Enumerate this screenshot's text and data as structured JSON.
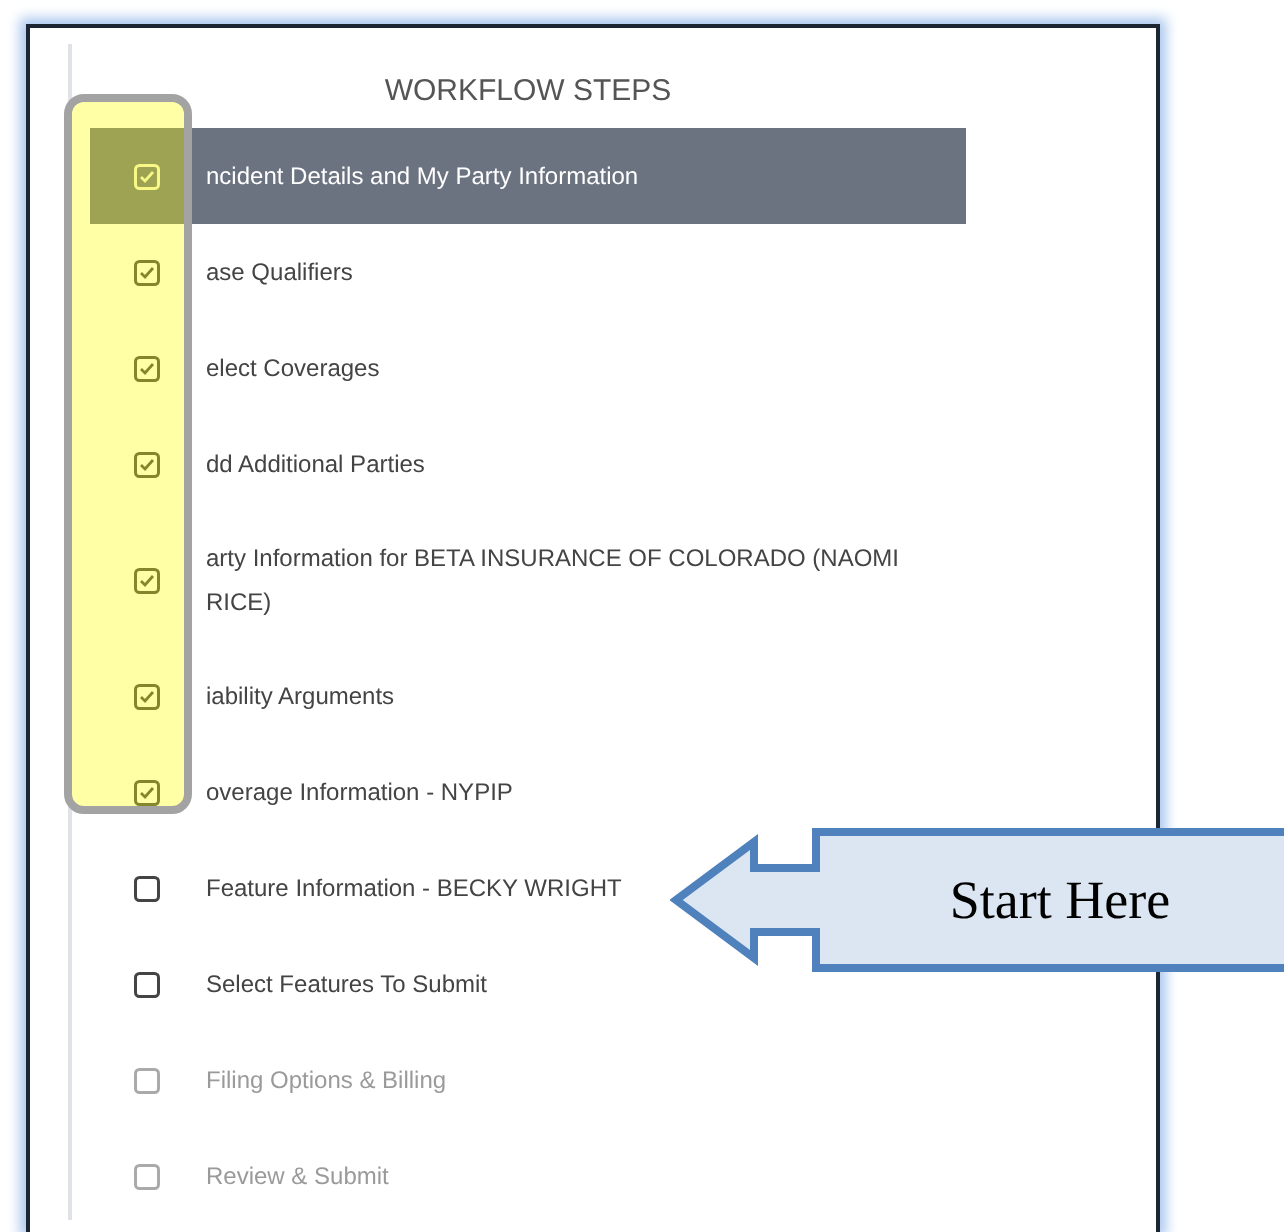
{
  "panel": {
    "title": "WORKFLOW STEPS"
  },
  "steps": [
    {
      "label": "ncident Details and My Party Information",
      "checked": true,
      "selected": true,
      "disabled": false
    },
    {
      "label": "ase Qualifiers",
      "checked": true,
      "selected": false,
      "disabled": false
    },
    {
      "label": "elect Coverages",
      "checked": true,
      "selected": false,
      "disabled": false
    },
    {
      "label": "dd Additional Parties",
      "checked": true,
      "selected": false,
      "disabled": false
    },
    {
      "label": "arty Information for BETA INSURANCE OF COLORADO (NAOMI RICE)",
      "checked": true,
      "selected": false,
      "disabled": false
    },
    {
      "label": "iability Arguments",
      "checked": true,
      "selected": false,
      "disabled": false
    },
    {
      "label": "overage Information - NYPIP",
      "checked": true,
      "selected": false,
      "disabled": false
    },
    {
      "label": "Feature Information - BECKY WRIGHT",
      "checked": false,
      "selected": false,
      "disabled": false
    },
    {
      "label": "Select Features To Submit",
      "checked": false,
      "selected": false,
      "disabled": false
    },
    {
      "label": "Filing Options & Billing",
      "checked": false,
      "selected": false,
      "disabled": true
    },
    {
      "label": "Review & Submit",
      "checked": false,
      "selected": false,
      "disabled": true
    }
  ],
  "callout": {
    "text": "Start Here"
  }
}
